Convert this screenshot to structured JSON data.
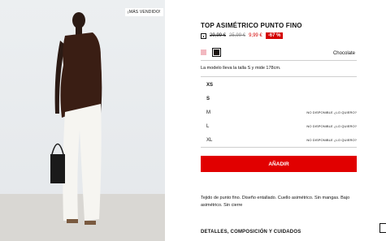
{
  "product": {
    "badge": "¡MÁS VENDIDO!",
    "title": "TOP ASIMÉTRICO PUNTO FINO",
    "price_original": "29,99 €",
    "price_previous": "25,99 €",
    "price_sale": "9,99 €",
    "discount": "-67 %",
    "color_name": "Chocolate",
    "model_info": "La modelo lleva la talla S y mide 178cm.",
    "sizes": [
      {
        "label": "XS",
        "note": ""
      },
      {
        "label": "S",
        "note": ""
      },
      {
        "label": "M",
        "note": "NO DISPONIBLE ¿LO QUIERO?"
      },
      {
        "label": "L",
        "note": "NO DISPONIBLE ¿LO QUIERO?"
      },
      {
        "label": "XL",
        "note": "NO DISPONIBLE ¿LO QUIERO?"
      }
    ],
    "add_button": "AÑADIR",
    "description": "Tejido de punto fino. Diseño entallado. Cuello asimétrico. Sin mangas. Bajo asimétrico. Sin cierre",
    "details_label": "DETALLES, COMPOSICIÓN Y CUIDADOS"
  },
  "colors": {
    "swatch_pink": "#f2b8c0",
    "swatch_chocolate": "#1b1410",
    "accent": "#e10000"
  }
}
